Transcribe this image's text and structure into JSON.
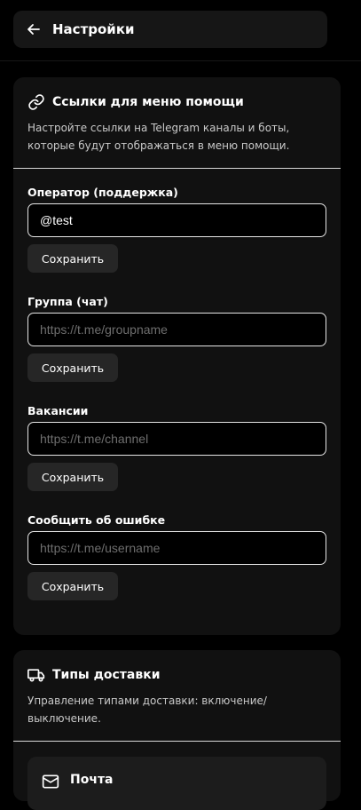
{
  "header": {
    "title": "Настройки",
    "back_icon": "arrow-left-icon"
  },
  "help_links": {
    "title": "Ссылки для меню помощи",
    "icon": "link-icon",
    "description": "Настройте ссылки на Telegram каналы и боты, которые будут отображаться в меню помощи.",
    "fields": [
      {
        "label": "Оператор (поддержка)",
        "value": "@test",
        "placeholder": "",
        "save_label": "Сохранить"
      },
      {
        "label": "Группа (чат)",
        "value": "",
        "placeholder": "https://t.me/groupname",
        "save_label": "Сохранить"
      },
      {
        "label": "Вакансии",
        "value": "",
        "placeholder": "https://t.me/channel",
        "save_label": "Сохранить"
      },
      {
        "label": "Сообщить об ошибке",
        "value": "",
        "placeholder": "https://t.me/username",
        "save_label": "Сохранить"
      }
    ]
  },
  "delivery_types": {
    "title": "Типы доставки",
    "icon": "truck-icon",
    "description": "Управление типами доставки: включение/выключение.",
    "items": [
      {
        "label": "Почта",
        "icon": "mail-icon"
      }
    ]
  }
}
